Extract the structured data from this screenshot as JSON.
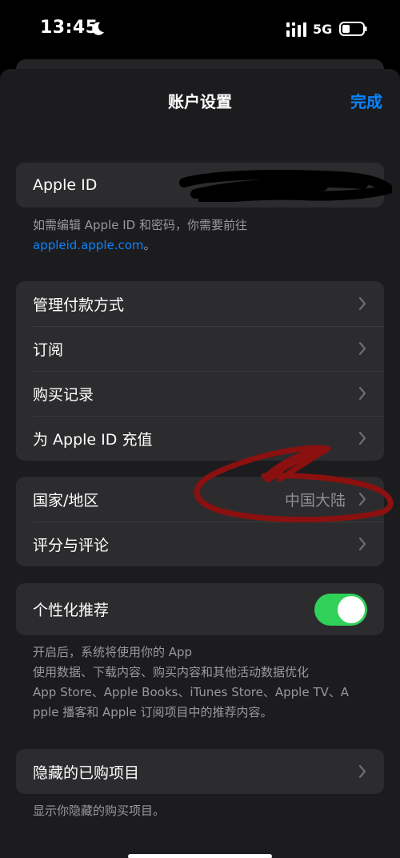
{
  "status_bar": {
    "time": "13:45",
    "network": "5G",
    "icons": [
      "moon-icon",
      "signal-icon",
      "battery-icon"
    ]
  },
  "nav": {
    "title": "账户设置",
    "done_label": "完成"
  },
  "apple_id": {
    "label": "Apple ID",
    "note": "如需编辑 Apple ID 和密码，你需要前往",
    "link": "appleid.apple.com",
    "note_end": "。"
  },
  "menu1": {
    "items": [
      {
        "label": "管理付款方式"
      },
      {
        "label": "订阅"
      },
      {
        "label": "购买记录"
      },
      {
        "label": "为 Apple ID 充值"
      }
    ]
  },
  "menu2": {
    "items": [
      {
        "label": "国家/地区",
        "value": "中国大陆"
      },
      {
        "label": "评分与评论"
      }
    ]
  },
  "personalized": {
    "label": "个性化推荐",
    "enabled": true,
    "description_lines": [
      "开启后，系统将使用你的 App",
      "使用数据、下载内容、购买内容和其他活动数据优化",
      "App Store、Apple Books、iTunes Store、Apple TV、A",
      "pple 播客和 Apple 订阅项目中的推荐内容。"
    ]
  },
  "hidden_purchases": {
    "label": "隐藏的已购项目",
    "footer": "显示你隐藏的购买项目。"
  },
  "colors": {
    "accent": "#0a84ff",
    "toggle_on": "#30d158",
    "annotation_red": "#8b1010"
  }
}
